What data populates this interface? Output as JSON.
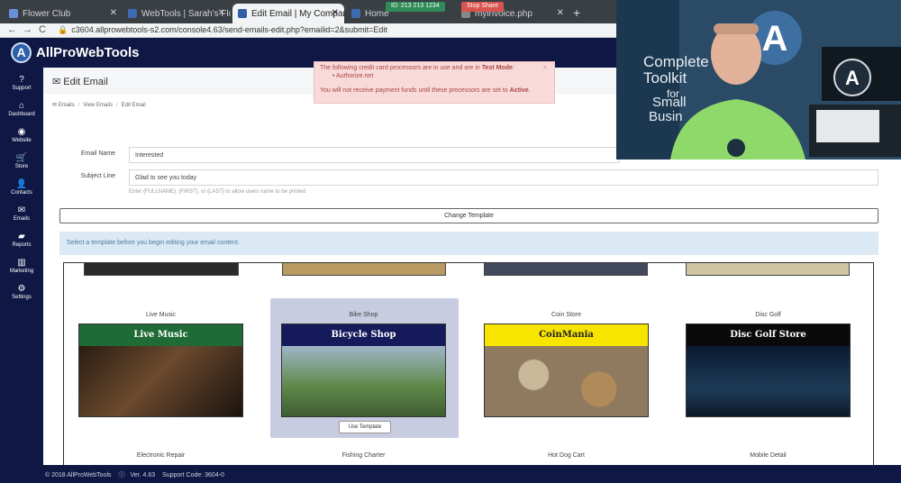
{
  "browser": {
    "tabs": [
      {
        "label": "Flower Club",
        "color": "#6a8fd8"
      },
      {
        "label": "WebTools | Sarah's Flowe",
        "color": "#3d6bb3"
      },
      {
        "label": "Edit Email | My Company*",
        "color": "#2f5fa8",
        "active": true
      },
      {
        "label": "Home",
        "color": "#3d6bb3"
      },
      {
        "label": "myinvoice.php",
        "color": "#888888"
      }
    ],
    "new_tab": "+",
    "share_indicator": "ID: 213 213 1234",
    "stop_share": "Stop Share",
    "url": "c3604.allprowebtools-s2.com/console4.63/send-emails-edit.php?emailid=2&submit=Edit",
    "back": "←",
    "forward": "→",
    "reload": "C"
  },
  "app": {
    "logo_letter": "A",
    "logo_text": "AllProWebTools"
  },
  "sidebar": {
    "items": [
      {
        "label": "Support",
        "icon": "?"
      },
      {
        "label": "Dashboard",
        "icon": "⌂"
      },
      {
        "label": "Website",
        "icon": "◉"
      },
      {
        "label": "Store",
        "icon": "🛒"
      },
      {
        "label": "Contacts",
        "icon": "👤"
      },
      {
        "label": "Emails",
        "icon": "✉"
      },
      {
        "label": "Reports",
        "icon": "▰"
      },
      {
        "label": "Marketing",
        "icon": "▥"
      },
      {
        "label": "Settings",
        "icon": "⚙"
      }
    ]
  },
  "page": {
    "title": "Edit Email",
    "breadcrumbs": [
      "Emails",
      "View Emails",
      "Edit Email"
    ]
  },
  "alert": {
    "line1_pre": "The following credit card processors are in use and are in ",
    "line1_bold": "Test Mode",
    "line1_post": ":",
    "item": "Authorize.net",
    "line2_pre": "You will not receive payment funds until these processors are set to ",
    "line2_bold": "Active",
    "line2_post": ".",
    "close": "×"
  },
  "form": {
    "email_name_label": "Email Name",
    "email_name_value": "Interested",
    "subject_label": "Subject Line",
    "subject_value": "Glad to see you today",
    "help": "Enter {FULLNAME}, {FIRST}, or {LAST} to allow users name to be printed",
    "change_template": "Change Template",
    "select_hint": "Select a template before you begin editing your email content."
  },
  "templates": {
    "row": [
      {
        "name": "Live Music",
        "banner": "Live Music",
        "band_bg": "#1e6b35",
        "band_fg": "#ffffff",
        "img_bg": "#3a2a1c"
      },
      {
        "name": "Bike Shop",
        "banner": "Bicycle Shop",
        "band_bg": "#141a5a",
        "band_fg": "#ffffff",
        "img_bg": "#6a8d54",
        "selected": true
      },
      {
        "name": "Coin Store",
        "banner": "CoinMania",
        "band_bg": "#f7e500",
        "band_fg": "#222222",
        "img_bg": "#8f7a5f"
      },
      {
        "name": "Disc Golf",
        "banner": "Disc Golf Store",
        "band_bg": "#0a0a0a",
        "band_fg": "#ffffff",
        "img_bg": "#0f2740"
      }
    ],
    "next_row": [
      "Electronic Repair",
      "Fishing Charter",
      "Hot Dog Cart",
      "Mobile Detail"
    ],
    "use_template": "Use Template"
  },
  "footer": {
    "copyright": "© 2018 AllProWebTools",
    "version": "Ver. 4.63",
    "support": "Support Code: 3604-0"
  },
  "webcam": {
    "sign_text_1": "Complete",
    "sign_text_2": "Toolkit",
    "sign_text_3": "for",
    "sign_text_4": "Small",
    "sign_text_5": "Busin"
  }
}
